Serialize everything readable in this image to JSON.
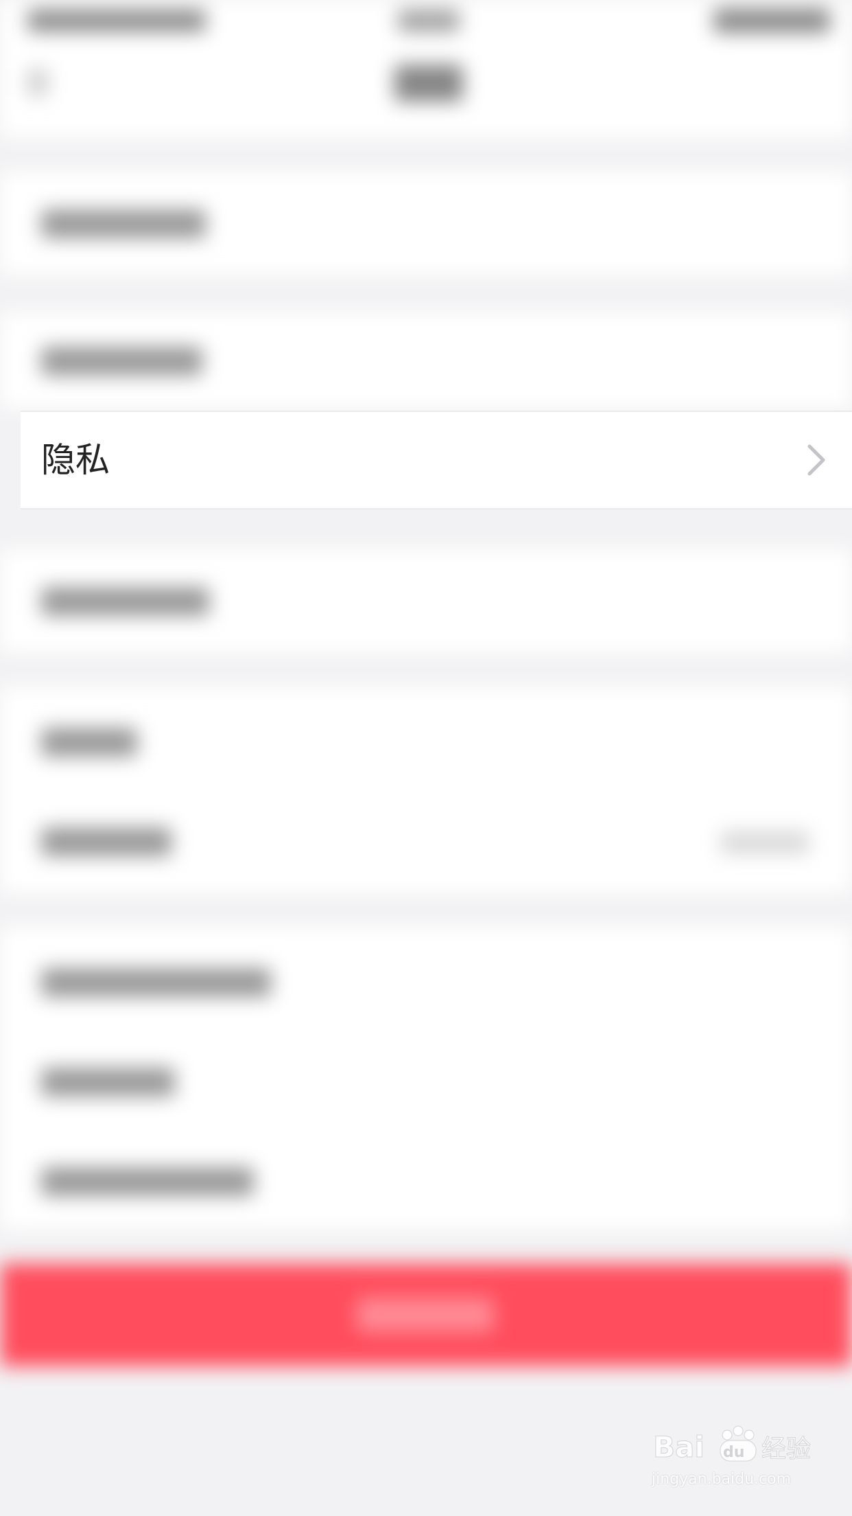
{
  "privacy_row": {
    "label": "隐私"
  },
  "watermark": {
    "brand_text": "Bai du 经验",
    "url": "jingyan.baidu.com"
  },
  "colors": {
    "background": "#f2f2f4",
    "row_background": "#ffffff",
    "logout_bar": "#ff4d5d",
    "label_text": "#222222",
    "chevron": "#c4c4c8"
  },
  "icons": {
    "row_chevron": "chevron-right-icon",
    "watermark_logo": "baidu-paw-icon"
  }
}
